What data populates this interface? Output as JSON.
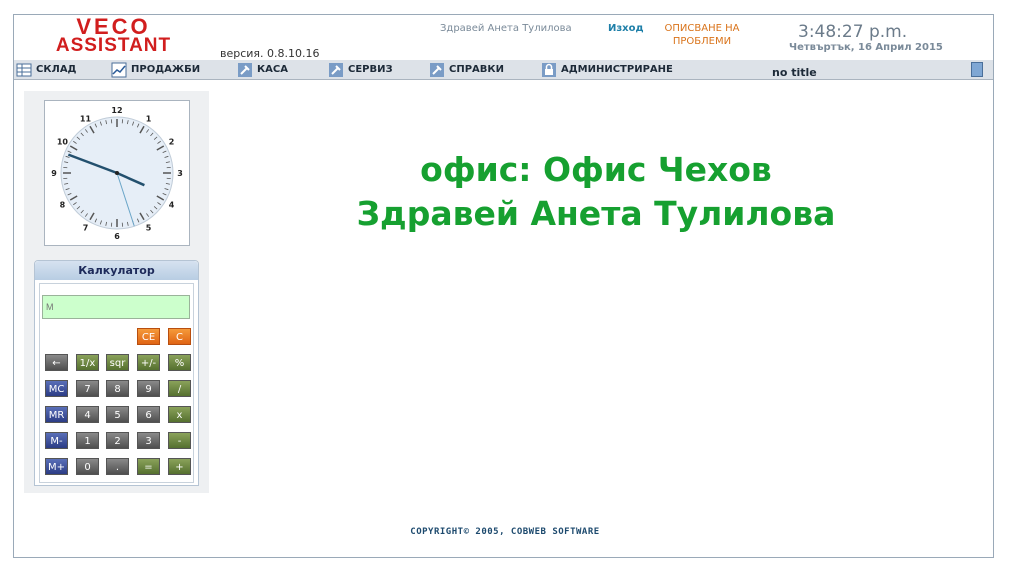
{
  "logo": {
    "line1": "VECO",
    "line2": "ASSISTANT"
  },
  "version": "версия. 0.8.10.16",
  "header": {
    "greeting": "Здравей  Анета Тулилова",
    "logout": "Изход",
    "report_problems_line1": "ОПИСВАНЕ НА",
    "report_problems_line2": "ПРОБЛЕМИ",
    "time": "3:48:27 p.m.",
    "date": "Четвъртък,  16 Април 2015"
  },
  "menu": {
    "items": [
      {
        "label": "СКЛАД",
        "icon": "warehouse-icon"
      },
      {
        "label": "ПРОДАЖБИ",
        "icon": "chart-icon"
      },
      {
        "label": "КАСА",
        "icon": "hammer-icon"
      },
      {
        "label": "СЕРВИЗ",
        "icon": "hammer-icon"
      },
      {
        "label": "СПРАВКИ",
        "icon": "hammer-icon"
      },
      {
        "label": "АДМИНИСТРИРАНЕ",
        "icon": "lock-icon"
      }
    ],
    "window_title": "no title"
  },
  "clock": {
    "numbers": [
      "12",
      "1",
      "2",
      "3",
      "4",
      "5",
      "6",
      "7",
      "8",
      "9",
      "10",
      "11"
    ],
    "hour": 3,
    "minute": 48,
    "second": 27
  },
  "calculator": {
    "title": "Калкулатор",
    "display_placeholder": "M",
    "buttons": {
      "ce": "CE",
      "c": "C",
      "back": "←",
      "inv": "1/x",
      "sqr": "sqr",
      "sign": "+/-",
      "pct": "%",
      "mc": "MC",
      "n7": "7",
      "n8": "8",
      "n9": "9",
      "div": "/",
      "mr": "MR",
      "n4": "4",
      "n5": "5",
      "n6": "6",
      "mul": "x",
      "mminus": "M-",
      "n1": "1",
      "n2": "2",
      "n3": "3",
      "sub": "-",
      "mplus": "M+",
      "n0": "0",
      "dot": ".",
      "eq": "=",
      "add": "+"
    }
  },
  "main": {
    "office_line": "офис: Офис Чехов",
    "welcome_line": "Здравей Анета Тулилова"
  },
  "footer": {
    "copyright": "COPYRIGHT© 2005, COBWEB SOFTWARE"
  }
}
